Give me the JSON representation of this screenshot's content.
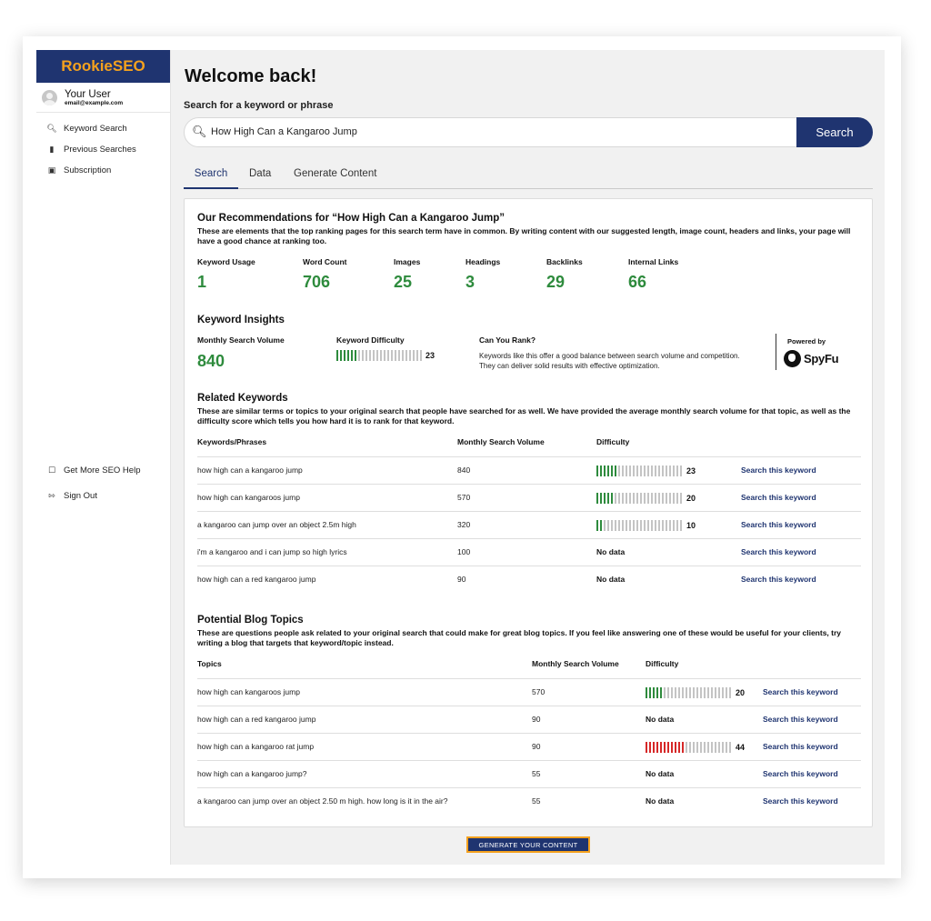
{
  "app": {
    "name": "RookieSEO"
  },
  "user": {
    "name": "Your User",
    "email": "email@example.com"
  },
  "sidebar": {
    "items": [
      {
        "label": "Keyword Search",
        "icon": "search-icon"
      },
      {
        "label": "Previous Searches",
        "icon": "folder-icon"
      },
      {
        "label": "Subscription",
        "icon": "subscription-icon"
      }
    ],
    "bottom_items": [
      {
        "label": "Get More SEO Help",
        "icon": "help-chat-icon"
      },
      {
        "label": "Sign Out",
        "icon": "sign-out-icon"
      }
    ]
  },
  "header": {
    "title": "Welcome back!"
  },
  "search": {
    "label": "Search for a keyword or phrase",
    "value": "How High Can a Kangaroo Jump",
    "button": "Search"
  },
  "tabs": [
    {
      "label": "Search",
      "active": true
    },
    {
      "label": "Data",
      "active": false
    },
    {
      "label": "Generate Content",
      "active": false
    }
  ],
  "recommendations": {
    "title": "Our Recommendations for “How High Can a Kangaroo Jump”",
    "description": "These are elements that the top ranking pages for this search term have in common. By writing content with our suggested length, image count, headers and links, your page will have a good chance at ranking too.",
    "stats": [
      {
        "label": "Keyword Usage",
        "value": "1"
      },
      {
        "label": "Word Count",
        "value": "706"
      },
      {
        "label": "Images",
        "value": "25"
      },
      {
        "label": "Headings",
        "value": "3"
      },
      {
        "label": "Backlinks",
        "value": "29"
      },
      {
        "label": "Internal Links",
        "value": "66"
      }
    ]
  },
  "insights": {
    "title": "Keyword Insights",
    "volume_label": "Monthly Search Volume",
    "volume_value": "840",
    "difficulty_label": "Keyword Difficulty",
    "difficulty_value": "23",
    "rank_title": "Can You Rank?",
    "rank_text": "Keywords like this offer a good balance between search volume and competition. They can deliver solid results with effective optimization.",
    "powered_by": "Powered by",
    "provider": "SpyFu"
  },
  "related": {
    "title": "Related Keywords",
    "description": "These are similar terms or topics to your original search that people have searched for as well. We have provided the average monthly search volume for that topic, as well as the difficulty score which tells you how hard it is to rank for that keyword.",
    "columns": [
      "Keywords/Phrases",
      "Monthly Search Volume",
      "Difficulty"
    ],
    "rows": [
      {
        "keyword": "how high can a kangaroo jump",
        "volume": "840",
        "difficulty": "23",
        "link": "Search this keyword"
      },
      {
        "keyword": "how high can kangaroos jump",
        "volume": "570",
        "difficulty": "20",
        "link": "Search this keyword"
      },
      {
        "keyword": "a kangaroo can jump over an object 2.5m high",
        "volume": "320",
        "difficulty": "10",
        "link": "Search this keyword"
      },
      {
        "keyword": "i'm a kangaroo and i can jump so high lyrics",
        "volume": "100",
        "difficulty": "No data",
        "link": "Search this keyword"
      },
      {
        "keyword": "how high can a red kangaroo jump",
        "volume": "90",
        "difficulty": "No data",
        "link": "Search this keyword"
      }
    ]
  },
  "blog": {
    "title": "Potential Blog Topics",
    "description": "These are questions people ask related to your original search that could make for great blog topics. If you feel like answering one of these would be useful for your clients, try writing a blog that targets that keyword/topic instead.",
    "columns": [
      "Topics",
      "Monthly Search Volume",
      "Difficulty"
    ],
    "rows": [
      {
        "topic": "how high can kangaroos jump",
        "volume": "570",
        "difficulty": "20",
        "link": "Search this keyword"
      },
      {
        "topic": "how high can a red kangaroo jump",
        "volume": "90",
        "difficulty": "No data",
        "link": "Search this keyword"
      },
      {
        "topic": "how high can a kangaroo rat jump",
        "volume": "90",
        "difficulty": "44",
        "link": "Search this keyword"
      },
      {
        "topic": "how high can a kangaroo jump?",
        "volume": "55",
        "difficulty": "No data",
        "link": "Search this keyword"
      },
      {
        "topic": "a kangaroo can jump over an object 2.50 m high. how long is it in the air?",
        "volume": "55",
        "difficulty": "No data",
        "link": "Search this keyword"
      }
    ]
  },
  "generate_button": "GENERATE YOUR CONTENT",
  "colors": {
    "brand": "#1f3470",
    "accent": "#f4a11e",
    "good": "#2e8b3d",
    "hard": "#d62828"
  }
}
